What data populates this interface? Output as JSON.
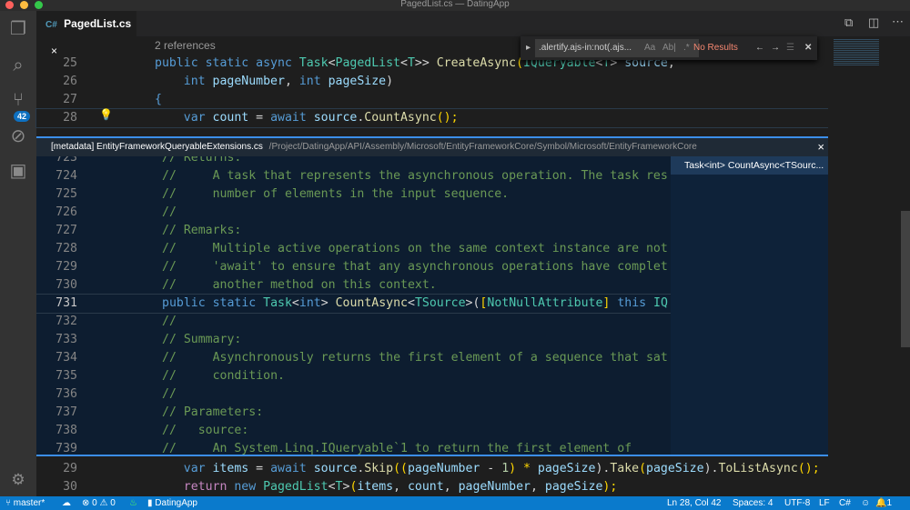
{
  "window": {
    "title": "PagedList.cs — DatingApp"
  },
  "colors": {
    "accent": "#0a7acc",
    "peek_border": "#3b8eea",
    "no_results": "#f48771"
  },
  "activity_bar": {
    "items": [
      {
        "icon": "files-icon"
      },
      {
        "icon": "search-icon"
      },
      {
        "icon": "source-control-icon"
      },
      {
        "icon": "debug-icon"
      },
      {
        "icon": "extensions-icon"
      }
    ],
    "scm_badge": "42",
    "settings_icon": "gear-icon"
  },
  "tab": {
    "lang": "C#",
    "label": "PagedList.cs",
    "close": "×"
  },
  "editor": {
    "codelens": "2 references",
    "top_lines": [
      {
        "n": "25",
        "indent": "",
        "tokens": [
          [
            "public static async ",
            "kw"
          ],
          [
            "Task",
            "ty"
          ],
          [
            "<",
            "pl"
          ],
          [
            "PagedList",
            "ty"
          ],
          [
            "<",
            "pl"
          ],
          [
            "T",
            "ty"
          ],
          [
            ">> ",
            "pl"
          ],
          [
            "CreateAsync",
            "fn"
          ],
          [
            "(",
            "br"
          ],
          [
            "IQueryable",
            "ty"
          ],
          [
            "<",
            "pl"
          ],
          [
            "T",
            "ty"
          ],
          [
            "> ",
            "pl"
          ],
          [
            "source",
            "id"
          ],
          [
            ",",
            "pl"
          ]
        ]
      },
      {
        "n": "26",
        "indent": "    ",
        "tokens": [
          [
            "int ",
            "kw"
          ],
          [
            "pageNumber",
            "id"
          ],
          [
            ", ",
            "pl"
          ],
          [
            "int ",
            "kw"
          ],
          [
            "pageSize",
            "id"
          ],
          [
            ")",
            "pl"
          ]
        ]
      },
      {
        "n": "27",
        "indent": "",
        "tokens": [
          [
            "{",
            "kw"
          ]
        ]
      },
      {
        "n": "28",
        "indent": "    ",
        "tokens": [
          [
            "var ",
            "kw"
          ],
          [
            "count",
            "id"
          ],
          [
            " = ",
            "pl"
          ],
          [
            "await ",
            "kw"
          ],
          [
            "source",
            "id"
          ],
          [
            ".",
            "pl"
          ],
          [
            "CountAsync",
            "fn"
          ],
          [
            "();",
            "br"
          ]
        ]
      }
    ],
    "bottom_lines": [
      {
        "n": "29",
        "indent": "    ",
        "tokens": [
          [
            "var ",
            "kw"
          ],
          [
            "items",
            "id"
          ],
          [
            " = ",
            "pl"
          ],
          [
            "await ",
            "kw"
          ],
          [
            "source",
            "id"
          ],
          [
            ".",
            "pl"
          ],
          [
            "Skip",
            "fn"
          ],
          [
            "((",
            "br"
          ],
          [
            "pageNumber",
            "id"
          ],
          [
            " - ",
            "pl"
          ],
          [
            "1",
            "nm"
          ],
          [
            ") * ",
            "br"
          ],
          [
            "pageSize",
            "id"
          ],
          [
            ").",
            "pl"
          ],
          [
            "Take",
            "fn"
          ],
          [
            "(",
            "br"
          ],
          [
            "pageSize",
            "id"
          ],
          [
            ").",
            "pl"
          ],
          [
            "ToListAsync",
            "fn"
          ],
          [
            "();",
            "br"
          ]
        ]
      },
      {
        "n": "30",
        "indent": "    ",
        "tokens": [
          [
            "return ",
            "ct"
          ],
          [
            "new ",
            "kw"
          ],
          [
            "PagedList",
            "ty"
          ],
          [
            "<",
            "pl"
          ],
          [
            "T",
            "ty"
          ],
          [
            ">",
            "pl"
          ],
          [
            "(",
            "br"
          ],
          [
            "items",
            "id"
          ],
          [
            ", ",
            "pl"
          ],
          [
            "count",
            "id"
          ],
          [
            ", ",
            "pl"
          ],
          [
            "pageNumber",
            "id"
          ],
          [
            ", ",
            "pl"
          ],
          [
            "pageSize",
            "id"
          ],
          [
            ");",
            "br"
          ]
        ]
      }
    ]
  },
  "find_widget": {
    "query": ".alertify.ajs-in:not(.ajs...",
    "match_case": "Aa",
    "whole_word": "Ab|",
    "regex": ".*",
    "result": "No Results"
  },
  "peek": {
    "file": "[metadata] EntityFrameworkQueryableExtensions.cs",
    "path": "/Project/DatingApp/API/Assembly/Microsoft/EntityFrameworkCore/Symbol/Microsoft/EntityFrameworkCore",
    "close": "×",
    "reference": "Task<int> CountAsync<TSourc...",
    "lines": [
      {
        "n": "723",
        "tokens": [
          [
            "// Returns:",
            "cm"
          ]
        ]
      },
      {
        "n": "724",
        "tokens": [
          [
            "//     A task that represents the asynchronous operation. The task res",
            "cm"
          ]
        ]
      },
      {
        "n": "725",
        "tokens": [
          [
            "//     number of elements in the input sequence.",
            "cm"
          ]
        ]
      },
      {
        "n": "726",
        "tokens": [
          [
            "//",
            "cm"
          ]
        ]
      },
      {
        "n": "727",
        "tokens": [
          [
            "// Remarks:",
            "cm"
          ]
        ]
      },
      {
        "n": "728",
        "tokens": [
          [
            "//     Multiple active operations on the same context instance are not",
            "cm"
          ]
        ]
      },
      {
        "n": "729",
        "tokens": [
          [
            "//     'await' to ensure that any asynchronous operations have complet",
            "cm"
          ]
        ]
      },
      {
        "n": "730",
        "tokens": [
          [
            "//     another method on this context.",
            "cm"
          ]
        ]
      },
      {
        "n": "731",
        "tokens": [
          [
            "public static ",
            "kw"
          ],
          [
            "Task",
            "ty"
          ],
          [
            "<",
            "pl"
          ],
          [
            "int",
            "kw"
          ],
          [
            "> ",
            "pl"
          ],
          [
            "CountAsync",
            "fn"
          ],
          [
            "<",
            "pl"
          ],
          [
            "TSource",
            "ty"
          ],
          [
            ">(",
            "pl"
          ],
          [
            "[",
            "br"
          ],
          [
            "NotNullAttribute",
            "ty"
          ],
          [
            "] ",
            "br"
          ],
          [
            "this ",
            "kw"
          ],
          [
            "IQ",
            "ty"
          ]
        ]
      },
      {
        "n": "732",
        "tokens": [
          [
            "//",
            "cm"
          ]
        ]
      },
      {
        "n": "733",
        "tokens": [
          [
            "// Summary:",
            "cm"
          ]
        ]
      },
      {
        "n": "734",
        "tokens": [
          [
            "//     Asynchronously returns the first element of a sequence that sat",
            "cm"
          ]
        ]
      },
      {
        "n": "735",
        "tokens": [
          [
            "//     condition.",
            "cm"
          ]
        ]
      },
      {
        "n": "736",
        "tokens": [
          [
            "//",
            "cm"
          ]
        ]
      },
      {
        "n": "737",
        "tokens": [
          [
            "// Parameters:",
            "cm"
          ]
        ]
      },
      {
        "n": "738",
        "tokens": [
          [
            "//   source:",
            "cm"
          ]
        ]
      },
      {
        "n": "739",
        "tokens": [
          [
            "//     An System.Linq.IQueryable`1 to return the first element of",
            "cm"
          ]
        ]
      }
    ]
  },
  "status_bar": {
    "branch": "master*",
    "sync_icon": "cloud-sync-icon",
    "errors": "0",
    "warnings": "0",
    "folder": "DatingApp",
    "position": "Ln 28, Col 42",
    "spaces": "Spaces: 4",
    "encoding": "UTF-8",
    "eol": "LF",
    "language": "C#",
    "feedback_icon": "smiley-icon",
    "notifications": "1"
  }
}
